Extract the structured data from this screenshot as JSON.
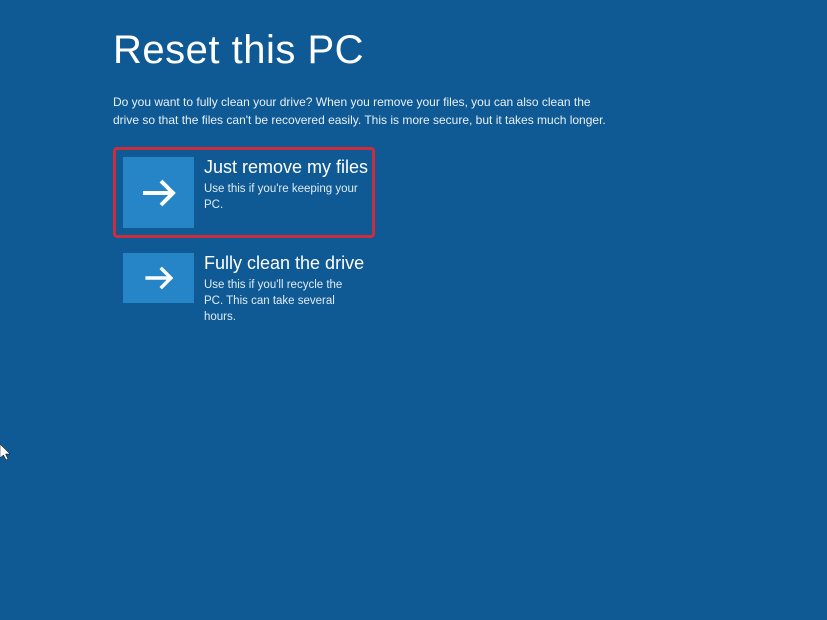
{
  "page": {
    "title": "Reset this PC",
    "description": "Do you want to fully clean your drive? When you remove your files, you can also clean the drive so that the files can't be recovered easily. This is more secure, but it takes much longer."
  },
  "options": [
    {
      "title": "Just remove my files",
      "description": "Use this if you're keeping your PC.",
      "highlighted": true
    },
    {
      "title": "Fully clean the drive",
      "description": "Use this if you'll recycle the PC. This can take several hours.",
      "highlighted": false
    }
  ],
  "colors": {
    "background": "#0F5A94",
    "accent": "#2585C7",
    "highlight_border": "#CC2E3C"
  }
}
